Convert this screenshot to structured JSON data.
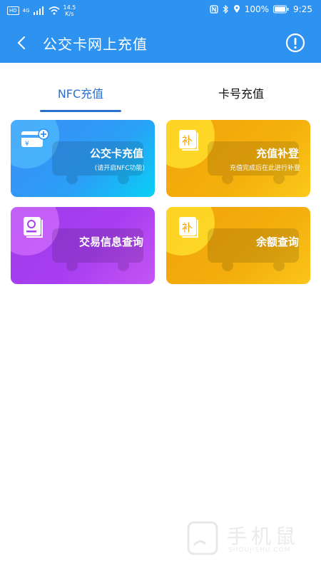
{
  "status_bar": {
    "hd": "HD",
    "network": "4G",
    "speed_value": "14.5",
    "speed_unit": "K/s",
    "battery": "100%",
    "time": "9:25",
    "icons": [
      "nfc-icon",
      "bluetooth-icon",
      "location-icon",
      "battery-icon",
      "wifi-icon",
      "signal-icon"
    ]
  },
  "header": {
    "title": "公交卡网上充值",
    "back_icon": "chevron-left-icon",
    "info_icon": "alert-circle-icon"
  },
  "tabs": [
    {
      "label": "NFC充值",
      "active": true
    },
    {
      "label": "卡号充值",
      "active": false
    }
  ],
  "cards": [
    {
      "title": "公交卡充值",
      "subtitle": "(请开启NFC功能)",
      "icon": "card-add-icon",
      "color": "#3c8cf7"
    },
    {
      "title": "充值补登",
      "subtitle": "充值完成后在此进行补登",
      "icon": "supplement-icon",
      "color": "#f2a40b"
    },
    {
      "title": "交易信息查询",
      "subtitle": "",
      "icon": "search-doc-icon",
      "color": "#9c3ce8"
    },
    {
      "title": "余额查询",
      "subtitle": "",
      "icon": "supplement-icon",
      "color": "#f1a30a"
    }
  ],
  "watermark": {
    "text": "手机鼠",
    "sub": "SHOUJISHU.COM"
  },
  "colors": {
    "appbar": "#2e93f0",
    "tab_active": "#2a6fcf"
  }
}
